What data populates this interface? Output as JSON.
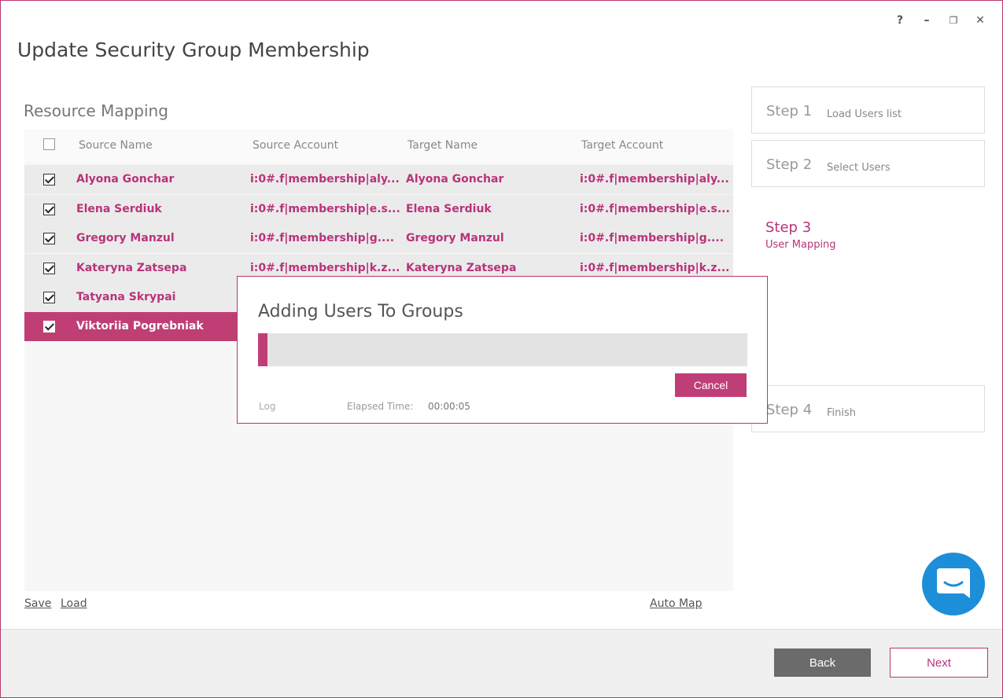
{
  "window": {
    "title": "Update Security Group Membership",
    "controls": {
      "help": "?",
      "minimize": "–",
      "restore": "❐",
      "close": "✕"
    }
  },
  "mapping": {
    "section_title": "Resource Mapping",
    "columns": {
      "source_name": "Source Name",
      "source_account": "Source Account",
      "target_name": "Target Name",
      "target_account": "Target Account"
    },
    "rows": [
      {
        "source_name": "Alyona Gonchar",
        "source_account": "i:0#.f|membership|aly...",
        "target_name": "Alyona Gonchar",
        "target_account": "i:0#.f|membership|aly...",
        "checked": true
      },
      {
        "source_name": "Elena Serdiuk",
        "source_account": "i:0#.f|membership|e.s...",
        "target_name": "Elena Serdiuk",
        "target_account": "i:0#.f|membership|e.s...",
        "checked": true
      },
      {
        "source_name": "Gregory Manzul",
        "source_account": "i:0#.f|membership|g....",
        "target_name": "Gregory Manzul",
        "target_account": "i:0#.f|membership|g....",
        "checked": true
      },
      {
        "source_name": "Kateryna Zatsepa",
        "source_account": "i:0#.f|membership|k.z...",
        "target_name": "Kateryna Zatsepa",
        "target_account": "i:0#.f|membership|k.z...",
        "checked": true
      },
      {
        "source_name": "Tatyana Skrypai",
        "checked": true
      },
      {
        "source_name": "Viktoriia Pogrebniak",
        "checked": true,
        "selected": true
      }
    ],
    "links": {
      "save": "Save",
      "load": "Load",
      "auto_map": "Auto Map"
    }
  },
  "steps": [
    {
      "num": "Step 1",
      "label": "Load Users list"
    },
    {
      "num": "Step 2",
      "label": "Select Users"
    },
    {
      "num": "Step 3",
      "label": "User Mapping",
      "active": true
    },
    {
      "num": "Step 4",
      "label": "Finish"
    }
  ],
  "dialog": {
    "title": "Adding Users To Groups",
    "progress": 0.02,
    "cancel": "Cancel",
    "log": "Log",
    "elapsed_label": "Elapsed Time:",
    "elapsed_value": "00:00:05"
  },
  "footer": {
    "back": "Back",
    "next": "Next"
  },
  "colors": {
    "accent": "#b8337a",
    "chat": "#1d8fd9",
    "back_button": "#6b6b6b"
  }
}
